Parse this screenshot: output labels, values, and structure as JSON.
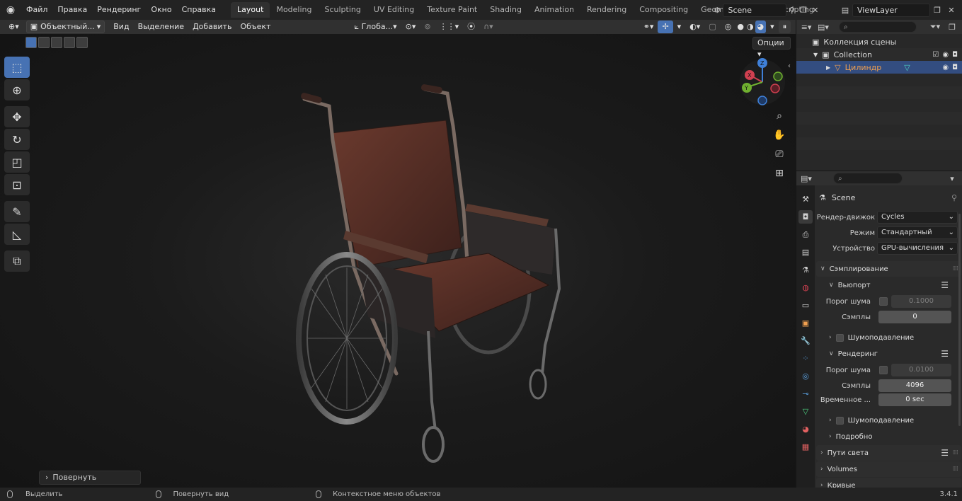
{
  "topbar": {
    "menus": [
      "Файл",
      "Правка",
      "Рендеринг",
      "Окно",
      "Справка"
    ],
    "workspaces": [
      "Layout",
      "Modeling",
      "Sculpting",
      "UV Editing",
      "Texture Paint",
      "Shading",
      "Animation",
      "Rendering",
      "Compositing",
      "Geometry Nodes",
      "Scripting"
    ],
    "active_workspace": "Layout",
    "scene": "Scene",
    "view_layer": "ViewLayer"
  },
  "viewport_header": {
    "mode": "Объектный...",
    "menus": [
      "Вид",
      "Выделение",
      "Добавить",
      "Объект"
    ],
    "orientation": "Глоба...",
    "options": "Опции"
  },
  "redo_panel": "Повернуть",
  "outliner": {
    "scene_collection": "Коллекция сцены",
    "collection": "Collection",
    "object": "Цилиндр"
  },
  "properties": {
    "title": "Scene",
    "render_engine_label": "Рендер-движок",
    "render_engine": "Cycles",
    "mode_label": "Режим",
    "mode": "Стандартный",
    "device_label": "Устройство",
    "device": "GPU-вычисления",
    "sampling": "Сэмплирование",
    "viewport": "Вьюпорт",
    "noise_threshold_label": "Порог шума",
    "viewport_noise_threshold": "0.1000",
    "samples_label": "Сэмплы",
    "viewport_samples": "0",
    "denoise": "Шумоподавление",
    "render": "Рендеринг",
    "render_noise_threshold": "0.0100",
    "render_samples": "4096",
    "time_limit_label": "Временное ...",
    "time_limit": "0 sec",
    "advanced": "Подробно",
    "light_paths": "Пути света",
    "volumes": "Volumes",
    "curves": "Кривые"
  },
  "statusbar": {
    "select": "Выделить",
    "rotate_view": "Повернуть вид",
    "context_menu": "Контекстное меню объектов",
    "version": "3.4.1"
  },
  "colors": {
    "accent": "#4772b3",
    "selection": "#334d80",
    "object_active": "#f0a050",
    "axis_x": "#d04050",
    "axis_y": "#70b030",
    "axis_z": "#3f80d8"
  }
}
